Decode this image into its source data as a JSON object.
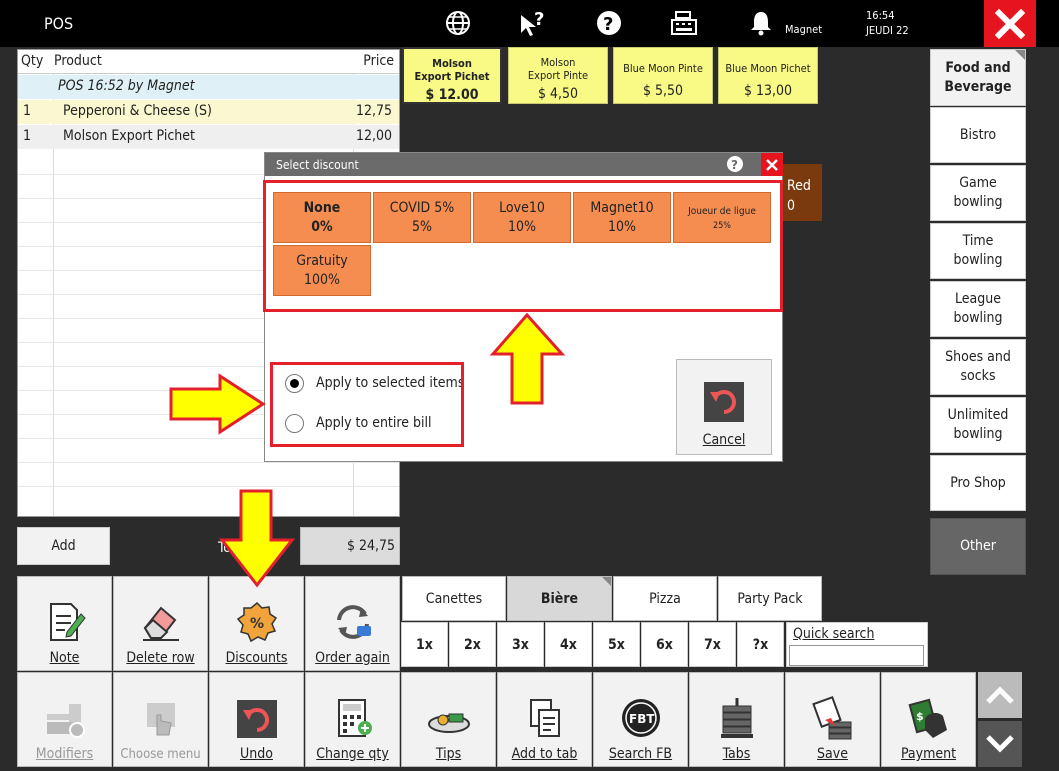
{
  "topbar": {
    "title": "POS",
    "user": "Magnet",
    "time": "16:54",
    "date": "JEUDI 22",
    "icons": [
      "globe-icon",
      "pointer-help-icon",
      "help-icon",
      "cash-register-icon",
      "bell-icon",
      "close-icon"
    ]
  },
  "order": {
    "headers": {
      "qty": "Qty",
      "product": "Product",
      "price": "Price"
    },
    "session_line": "POS 16:52 by Magnet",
    "items": [
      {
        "qty": "1",
        "product": "Pepperoni & Cheese (S)",
        "price": "12,75"
      },
      {
        "qty": "1",
        "product": "Molson Export Pichet",
        "price": "12,00"
      }
    ],
    "add_label": "Add",
    "total_label": "To",
    "total_value": "$ 24,75"
  },
  "products": [
    {
      "name": "Molson Export Pichet",
      "price": "$ 12.00"
    },
    {
      "name": "Molson Export Pinte",
      "price": "$ 4,50"
    },
    {
      "name": "Blue Moon Pinte",
      "price": "$ 5,50"
    },
    {
      "name": "Blue Moon Pichet",
      "price": "$ 13,00"
    }
  ],
  "partial_tile": {
    "line1": "Red",
    "line2": "0"
  },
  "categories": [
    "Food and Beverage",
    "Bistro",
    "Game bowling",
    "Time bowling",
    "League bowling",
    "Shoes and socks",
    "Unlimited bowling",
    "Pro Shop",
    "Other"
  ],
  "actions_row1": [
    "Note",
    "Delete row",
    "Discounts",
    "Order again"
  ],
  "actions_row2": [
    "Modifiers",
    "Choose menu",
    "Undo",
    "Change qty",
    "Tips",
    "Add to tab",
    "Search FB",
    "Tabs",
    "Save",
    "Payment"
  ],
  "tabs": [
    "Canettes",
    "Bière",
    "Pizza",
    "Party Pack"
  ],
  "qty_buttons": [
    "1x",
    "2x",
    "3x",
    "4x",
    "5x",
    "6x",
    "7x",
    "?x"
  ],
  "quick_search": {
    "label": "Quick search",
    "value": ""
  },
  "dialog": {
    "title": "Select discount",
    "discounts": [
      {
        "name": "None",
        "value": "0%"
      },
      {
        "name": "COVID 5%",
        "value": "5%"
      },
      {
        "name": "Love10",
        "value": "10%"
      },
      {
        "name": "Magnet10",
        "value": "10%"
      },
      {
        "name": "Joueur de ligue",
        "value": "25%"
      },
      {
        "name": "Gratuity",
        "value": "100%"
      }
    ],
    "apply_selected": "Apply to selected items",
    "apply_bill": "Apply to entire bill",
    "selected_option": "Apply to selected items",
    "cancel": "Cancel"
  },
  "colors": {
    "discount_tile": "#f58d50",
    "product_tile": "#f9f985",
    "highlight": "#e3202b",
    "arrow": "#ffff00"
  }
}
